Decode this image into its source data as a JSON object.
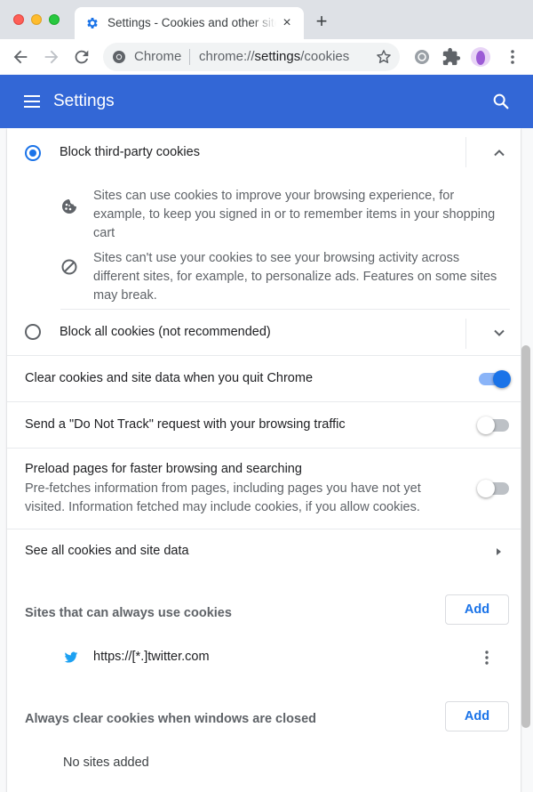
{
  "browser": {
    "tab_title": "Settings - Cookies and other site data",
    "tab_close": "×",
    "new_tab": "+",
    "omnibox": {
      "chip": "Chrome",
      "url_prefix": "chrome://",
      "url_host": "settings",
      "url_path": "/cookies"
    }
  },
  "header": {
    "title": "Settings"
  },
  "cookie_options": [
    {
      "label": "Block third-party cookies",
      "selected": true,
      "expanded": true,
      "details": [
        {
          "icon": "cookie-icon",
          "text": "Sites can use cookies to improve your browsing experience, for example, to keep you signed in or to remember items in your shopping cart"
        },
        {
          "icon": "block-icon",
          "text": "Sites can't use your cookies to see your browsing activity across different sites, for example, to personalize ads. Features on some sites may break."
        }
      ]
    },
    {
      "label": "Block all cookies (not recommended)",
      "selected": false,
      "expanded": false
    }
  ],
  "toggles": [
    {
      "label": "Clear cookies and site data when you quit Chrome",
      "on": true
    },
    {
      "label": "Send a \"Do Not Track\" request with your browsing traffic",
      "on": false
    },
    {
      "label": "Preload pages for faster browsing and searching",
      "sublabel": "Pre-fetches information from pages, including pages you have not yet visited. Information fetched may include cookies, if you allow cookies.",
      "on": false
    }
  ],
  "see_all": {
    "label": "See all cookies and site data"
  },
  "sections": {
    "allow": {
      "title": "Sites that can always use cookies",
      "add_label": "Add",
      "sites": [
        {
          "url": "https://[*.]twitter.com",
          "icon": "twitter-icon"
        }
      ]
    },
    "clear_on_exit": {
      "title": "Always clear cookies when windows are closed",
      "add_label": "Add",
      "empty_text": "No sites added"
    }
  },
  "colors": {
    "header": "#3367d6",
    "accent": "#1a73e8",
    "twitter": "#1da1f2"
  }
}
